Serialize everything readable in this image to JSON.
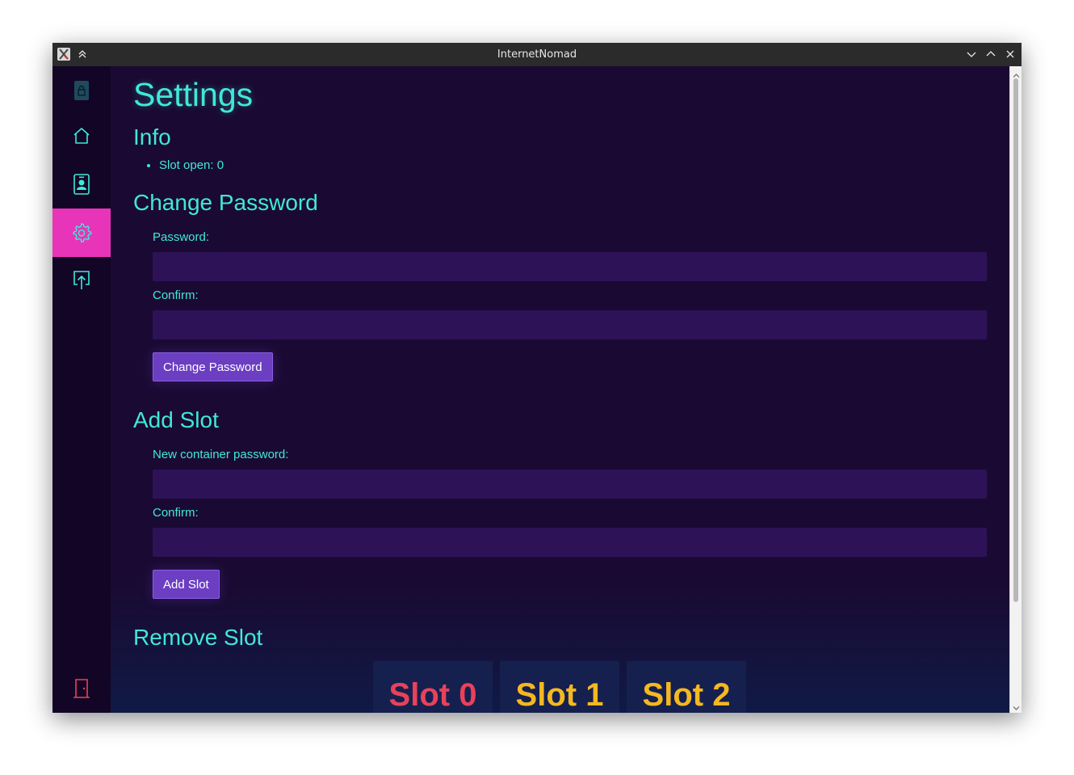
{
  "window": {
    "title": "InternetNomad"
  },
  "sidebar": {
    "items": [
      {
        "icon": "lock-icon"
      },
      {
        "icon": "home-icon"
      },
      {
        "icon": "contact-card-icon"
      },
      {
        "icon": "gear-icon",
        "active": true
      },
      {
        "icon": "upload-icon"
      },
      {
        "icon": "exit-door-icon"
      }
    ]
  },
  "page": {
    "title": "Settings",
    "info": {
      "heading": "Info",
      "items": [
        "Slot open: 0"
      ]
    },
    "change_password": {
      "heading": "Change Password",
      "password_label": "Password:",
      "password_value": "",
      "confirm_label": "Confirm:",
      "confirm_value": "",
      "button_label": "Change Password"
    },
    "add_slot": {
      "heading": "Add Slot",
      "new_password_label": "New container password:",
      "new_password_value": "",
      "confirm_label": "Confirm:",
      "confirm_value": "",
      "button_label": "Add Slot"
    },
    "remove_slot": {
      "heading": "Remove Slot",
      "slots": [
        {
          "label": "Slot 0",
          "color": "#e8425a"
        },
        {
          "label": "Slot 1",
          "color": "#f5b820"
        },
        {
          "label": "Slot 2",
          "color": "#f5b820"
        }
      ]
    }
  },
  "colors": {
    "accent": "#40e8d8",
    "active_nav": "#e834b8",
    "button": "#6b3ec2",
    "input_bg": "#2e1257",
    "background": "#1a0a33"
  }
}
